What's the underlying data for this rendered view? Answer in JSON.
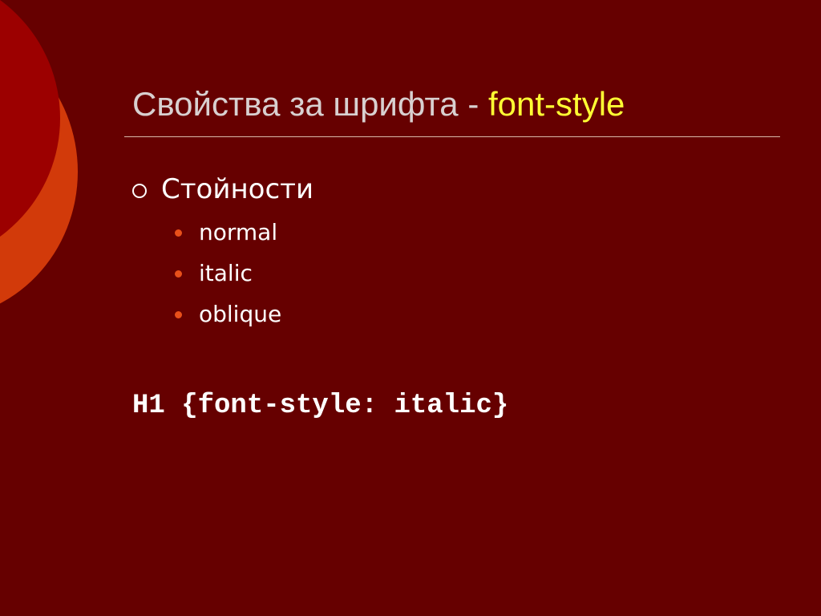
{
  "slide": {
    "title_main": "Свойства за шрифта - ",
    "title_accent": "font-style",
    "bullet_heading": "Стойности",
    "values": [
      "normal",
      "italic",
      "oblique"
    ],
    "code_example": "H1 {font-style: italic}"
  },
  "colors": {
    "background": "#660000",
    "title_text": "#d8d0d0",
    "accent_text": "#ffff33",
    "bullet_dot": "#e8501a",
    "circle_inner": "#9c0000",
    "circle_outer": "#d23a0a"
  },
  "icons": {
    "level1_bullet": "ring-bullet-icon",
    "level2_bullet": "dot-bullet-icon"
  }
}
